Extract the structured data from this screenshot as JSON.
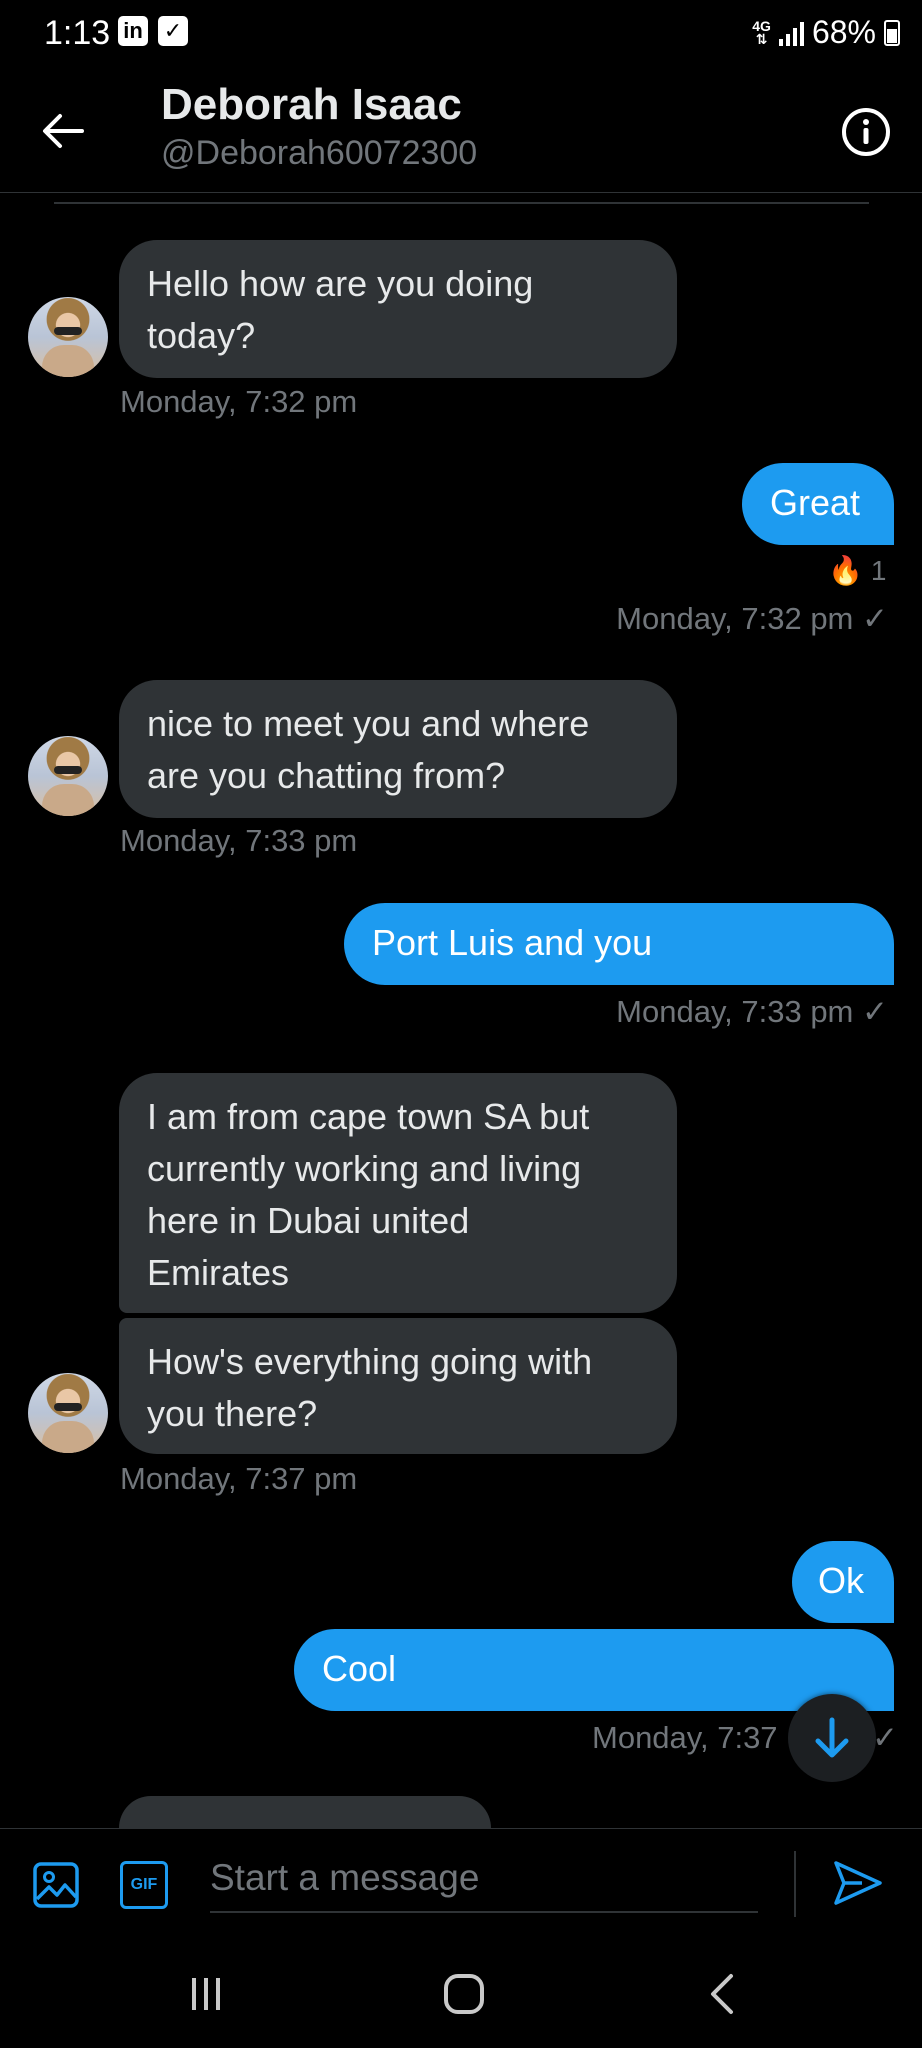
{
  "status_bar": {
    "time": "1:13",
    "app_icon_1": "in",
    "app_icon_2": "✓",
    "network": "4G",
    "battery": "68%"
  },
  "header": {
    "title": "Deborah Isaac",
    "handle": "@Deborah60072300"
  },
  "messages": [
    {
      "direction": "in",
      "lines": [
        "Hello how are you doing",
        "today?"
      ],
      "timestamp": "Monday, 7:32 pm"
    },
    {
      "direction": "out",
      "text": "Great",
      "reaction": {
        "emoji": "🔥",
        "count": "1"
      },
      "timestamp": "Monday, 7:32 pm"
    },
    {
      "direction": "in",
      "lines": [
        "nice to meet you and where",
        "are you chatting from?"
      ],
      "timestamp": "Monday, 7:33 pm"
    },
    {
      "direction": "out",
      "text": "Port Luis and you",
      "timestamp": "Monday, 7:33 pm"
    },
    {
      "direction": "in",
      "lines": [
        "I am from cape town SA but",
        "currently working and living",
        "here in Dubai united",
        "Emirates"
      ]
    },
    {
      "direction": "in",
      "lines": [
        "How's everything going with",
        "you there?"
      ],
      "timestamp": "Monday, 7:37 pm"
    },
    {
      "direction": "out",
      "text": "Ok"
    },
    {
      "direction": "out",
      "text": "Cool",
      "timestamp": "Monday, 7:37"
    }
  ],
  "sent_check": "✓",
  "composer": {
    "placeholder": "Start a message",
    "gif_label": "GIF"
  },
  "colors": {
    "accent": "#1d9bf0",
    "incoming_bubble": "#2f3336",
    "background": "#000000",
    "secondary_text": "#71767b"
  }
}
